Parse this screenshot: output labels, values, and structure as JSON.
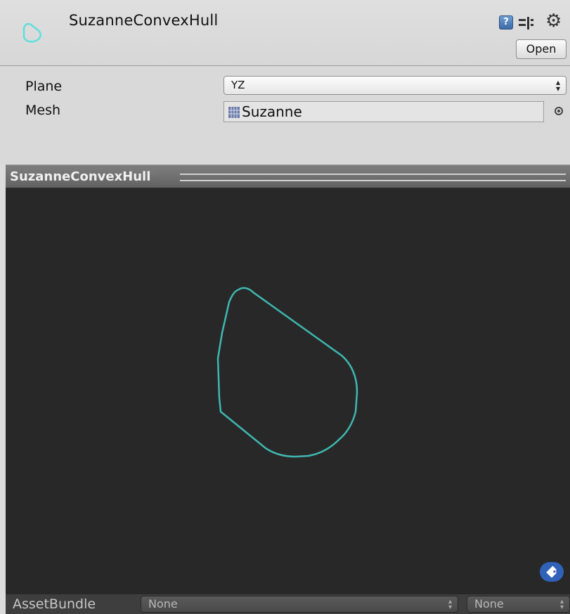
{
  "header": {
    "title": "SuzanneConvexHull",
    "open_label": "Open",
    "icons": [
      "convex-hull-asset-icon",
      "help-icon",
      "presets-icon",
      "gear-icon"
    ]
  },
  "inspector": {
    "plane": {
      "label": "Plane",
      "value": "YZ"
    },
    "mesh": {
      "label": "Mesh",
      "value": "Suzanne"
    }
  },
  "preview": {
    "title": "SuzanneConvexHull",
    "background_color": "#282828",
    "hull_color": "#3fb8b0"
  },
  "footer": {
    "label": "AssetBundle",
    "bundle_name": "None",
    "bundle_variant": "None"
  }
}
